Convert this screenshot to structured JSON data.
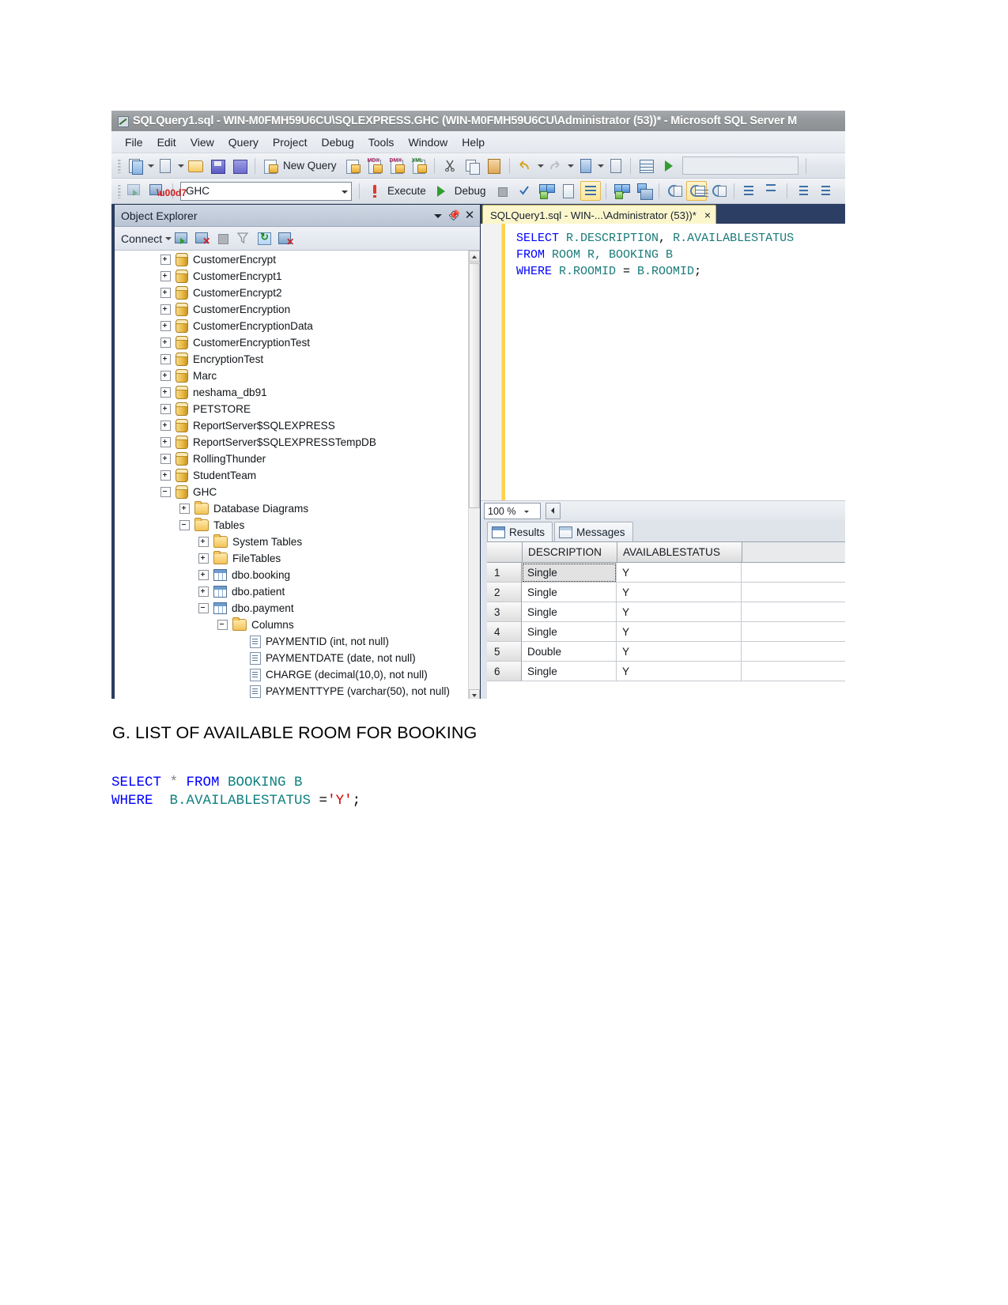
{
  "window": {
    "title": "SQLQuery1.sql - WIN-M0FMH59U6CU\\SQLEXPRESS.GHC (WIN-M0FMH59U6CU\\Administrator (53))* - Microsoft SQL Server M",
    "icon": "sql-query-file-icon"
  },
  "menubar": {
    "items": [
      "File",
      "Edit",
      "View",
      "Query",
      "Project",
      "Debug",
      "Tools",
      "Window",
      "Help"
    ]
  },
  "toolbar_main": {
    "new_query_label": "New Query",
    "icons": [
      "new-project-icon",
      "new-item-icon",
      "open-file-icon",
      "save-icon",
      "save-all-icon",
      "new-query-icon",
      "new-database-engine-query-icon",
      "new-analysis-services-mdx-query-icon",
      "new-analysis-services-dmx-query-icon",
      "new-analysis-services-xmla-query-icon",
      "cut-icon",
      "copy-icon",
      "paste-icon",
      "undo-icon",
      "redo-icon",
      "navigate-backward-icon",
      "navigate-forward-icon",
      "show-diagram-pane-icon",
      "start-debugging-icon"
    ]
  },
  "toolbar_query": {
    "database_combo_value": "GHC",
    "execute_label": "Execute",
    "debug_label": "Debug",
    "icons": [
      "connect-icon",
      "disconnect-icon",
      "execute-icon",
      "debug-icon",
      "stop-icon",
      "parse-icon",
      "display-estimated-execution-plan-icon",
      "query-options-icon",
      "include-actual-execution-plan-icon",
      "include-client-statistics-icon",
      "results-to-text-icon",
      "results-to-grid-icon",
      "results-to-file-icon",
      "comment-out-icon",
      "uncomment-icon",
      "decrease-indent-icon",
      "increase-indent-icon"
    ]
  },
  "object_explorer": {
    "title": "Object Explorer",
    "connect_label": "Connect",
    "toolbar_icons": [
      "connect-object-explorer-icon",
      "disconnect-object-explorer-icon",
      "stop-icon",
      "filter-icon",
      "refresh-icon",
      "activity-monitor-icon"
    ],
    "header_buttons": [
      "chevron-down-icon",
      "pin-icon",
      "close-icon"
    ],
    "tree": [
      {
        "label": "CustomerEncrypt",
        "indent": 0,
        "expander": "plus",
        "icon": "database-icon"
      },
      {
        "label": "CustomerEncrypt1",
        "indent": 0,
        "expander": "plus",
        "icon": "database-icon"
      },
      {
        "label": "CustomerEncrypt2",
        "indent": 0,
        "expander": "plus",
        "icon": "database-icon"
      },
      {
        "label": "CustomerEncryption",
        "indent": 0,
        "expander": "plus",
        "icon": "database-icon"
      },
      {
        "label": "CustomerEncryptionData",
        "indent": 0,
        "expander": "plus",
        "icon": "database-icon"
      },
      {
        "label": "CustomerEncryptionTest",
        "indent": 0,
        "expander": "plus",
        "icon": "database-icon"
      },
      {
        "label": "EncryptionTest",
        "indent": 0,
        "expander": "plus",
        "icon": "database-icon"
      },
      {
        "label": "Marc",
        "indent": 0,
        "expander": "plus",
        "icon": "database-icon"
      },
      {
        "label": "neshama_db91",
        "indent": 0,
        "expander": "plus",
        "icon": "database-icon"
      },
      {
        "label": "PETSTORE",
        "indent": 0,
        "expander": "plus",
        "icon": "database-icon"
      },
      {
        "label": "ReportServer$SQLEXPRESS",
        "indent": 0,
        "expander": "plus",
        "icon": "database-icon"
      },
      {
        "label": "ReportServer$SQLEXPRESSTempDB",
        "indent": 0,
        "expander": "plus",
        "icon": "database-icon"
      },
      {
        "label": "RollingThunder",
        "indent": 0,
        "expander": "plus",
        "icon": "database-icon"
      },
      {
        "label": "StudentTeam",
        "indent": 0,
        "expander": "plus",
        "icon": "database-icon"
      },
      {
        "label": "GHC",
        "indent": 0,
        "expander": "minus",
        "icon": "database-icon"
      },
      {
        "label": "Database Diagrams",
        "indent": 1,
        "expander": "plus",
        "icon": "folder-icon"
      },
      {
        "label": "Tables",
        "indent": 1,
        "expander": "minus",
        "icon": "folder-icon"
      },
      {
        "label": "System Tables",
        "indent": 2,
        "expander": "plus",
        "icon": "folder-icon"
      },
      {
        "label": "FileTables",
        "indent": 2,
        "expander": "plus",
        "icon": "folder-icon"
      },
      {
        "label": "dbo.booking",
        "indent": 2,
        "expander": "plus",
        "icon": "table-icon"
      },
      {
        "label": "dbo.patient",
        "indent": 2,
        "expander": "plus",
        "icon": "table-icon"
      },
      {
        "label": "dbo.payment",
        "indent": 2,
        "expander": "minus",
        "icon": "table-icon"
      },
      {
        "label": "Columns",
        "indent": 3,
        "expander": "minus",
        "icon": "folder-icon"
      },
      {
        "label": "PAYMENTID (int, not null)",
        "indent": 4,
        "expander": "none",
        "icon": "column-icon"
      },
      {
        "label": "PAYMENTDATE (date, not null)",
        "indent": 4,
        "expander": "none",
        "icon": "column-icon"
      },
      {
        "label": "CHARGE (decimal(10,0), not null)",
        "indent": 4,
        "expander": "none",
        "icon": "column-icon"
      },
      {
        "label": "PAYMENTTYPE (varchar(50), not null)",
        "indent": 4,
        "expander": "none",
        "icon": "column-icon"
      }
    ]
  },
  "editor": {
    "tab_label": "SQLQuery1.sql - WIN-...\\Administrator (53))*",
    "tab_close": "×",
    "code_lines": [
      [
        {
          "t": "SELECT ",
          "c": "kw"
        },
        {
          "t": "R.DESCRIPTION",
          "c": "ident"
        },
        {
          "t": ", ",
          "c": "plain"
        },
        {
          "t": "R.AVAILABLESTATUS",
          "c": "ident"
        }
      ],
      [
        {
          "t": "FROM ",
          "c": "kw"
        },
        {
          "t": "ROOM R, BOOKING B",
          "c": "ident"
        }
      ],
      [
        {
          "t": "WHERE ",
          "c": "kw"
        },
        {
          "t": "R.ROOMID",
          "c": "ident"
        },
        {
          "t": " = ",
          "c": "plain"
        },
        {
          "t": "B.ROOMID",
          "c": "ident"
        },
        {
          "t": ";",
          "c": "plain"
        }
      ]
    ],
    "zoom_value": "100 %"
  },
  "results": {
    "tabs": [
      {
        "label": "Results",
        "icon": "grid-results-icon",
        "selected": true
      },
      {
        "label": "Messages",
        "icon": "messages-icon",
        "selected": false
      }
    ],
    "columns": [
      "DESCRIPTION",
      "AVAILABLESTATUS"
    ],
    "rows": [
      {
        "n": "1",
        "description": "Single",
        "availablestatus": "Y",
        "selected": true
      },
      {
        "n": "2",
        "description": "Single",
        "availablestatus": "Y",
        "selected": false
      },
      {
        "n": "3",
        "description": "Single",
        "availablestatus": "Y",
        "selected": false
      },
      {
        "n": "4",
        "description": "Single",
        "availablestatus": "Y",
        "selected": false
      },
      {
        "n": "5",
        "description": "Double",
        "availablestatus": "Y",
        "selected": false
      },
      {
        "n": "6",
        "description": "Single",
        "availablestatus": "Y",
        "selected": false
      }
    ]
  },
  "document": {
    "heading": "G. LIST OF AVAILABLE ROOM FOR BOOKING",
    "code_lines": [
      [
        {
          "t": "SELECT ",
          "c": "c-kw"
        },
        {
          "t": "* ",
          "c": "c-star"
        },
        {
          "t": "FROM ",
          "c": "c-kw"
        },
        {
          "t": "BOOKING B",
          "c": "c-tbl"
        }
      ],
      [
        {
          "t": "WHERE  ",
          "c": "c-kw"
        },
        {
          "t": "B.AVAILABLESTATUS ",
          "c": "c-tbl"
        },
        {
          "t": "=",
          "c": "c-plain"
        },
        {
          "t": "'Y'",
          "c": "c-str"
        },
        {
          "t": ";",
          "c": "c-plain"
        }
      ]
    ]
  },
  "colors": {
    "titlebar": "#8d9093",
    "workarea_blue": "#2c3e63",
    "tab_yellow": "#fcf6cc",
    "keyword_blue": "#0000ff",
    "identifier_teal": "#1a7a7a",
    "string_red": "#cc0000"
  }
}
